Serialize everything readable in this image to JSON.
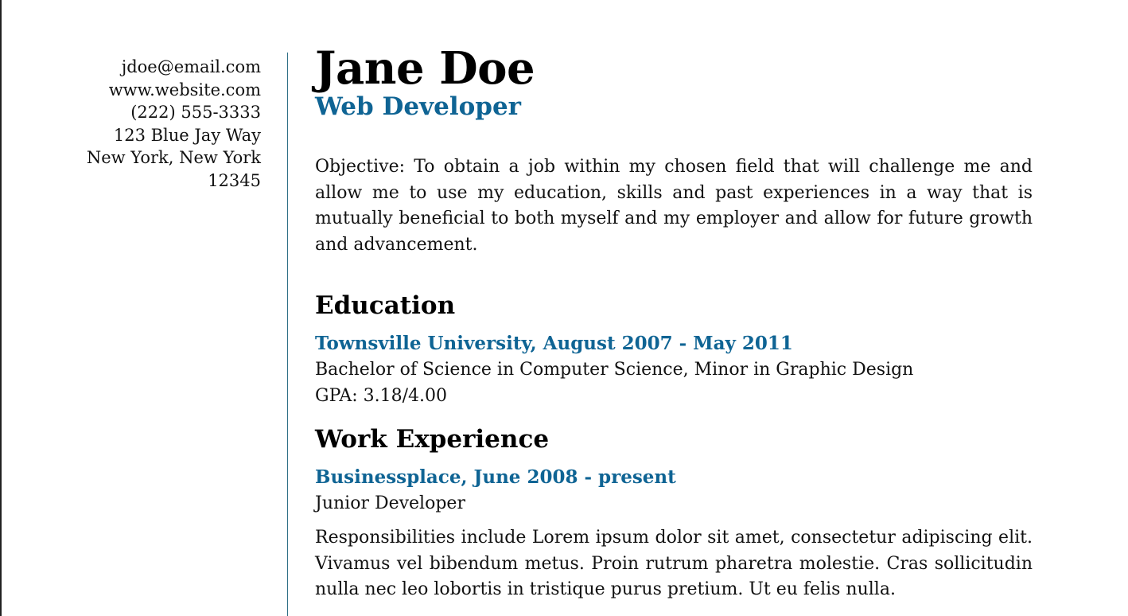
{
  "contact": {
    "email": "jdoe@email.com",
    "website": "www.website.com",
    "phone": "(222) 555-3333",
    "street": "123 Blue Jay Way",
    "city_state": "New York, New York",
    "zip": "12345"
  },
  "header": {
    "name": "Jane Doe",
    "title": "Web Developer"
  },
  "objective": "Objective:  To obtain a job within my chosen field that will challenge me and allow me to use my education, skills and past experiences in a way that is mutually beneficial to both myself and my employer and allow for future growth and advancement.",
  "education": {
    "heading": "Education",
    "entry": {
      "school_dates": "Townsville University, August 2007 - May 2011",
      "degree": "Bachelor of Science in Computer Science, Minor in Graphic Design",
      "gpa": "GPA: 3.18/4.00"
    }
  },
  "work": {
    "heading": "Work Experience",
    "entry": {
      "company_dates": "Businessplace, June 2008 - present",
      "position": "Junior Developer",
      "responsibilities": "Responsibilities include Lorem ipsum dolor sit amet, consectetur adipiscing elit. Vivamus vel bibendum metus. Proin rutrum pharetra molestie. Cras sollicitudin nulla nec leo lobortis in tristique purus pretium. Ut eu felis nulla."
    }
  },
  "colors": {
    "accent": "#0f6494",
    "rule": "#2f6f86",
    "text": "#111111"
  }
}
